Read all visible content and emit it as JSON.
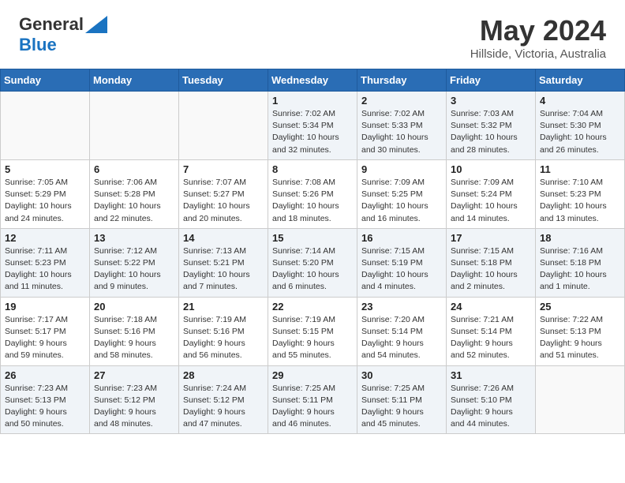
{
  "header": {
    "logo_general": "General",
    "logo_blue": "Blue",
    "month_year": "May 2024",
    "location": "Hillside, Victoria, Australia"
  },
  "days_of_week": [
    "Sunday",
    "Monday",
    "Tuesday",
    "Wednesday",
    "Thursday",
    "Friday",
    "Saturday"
  ],
  "weeks": [
    [
      {
        "num": "",
        "info": ""
      },
      {
        "num": "",
        "info": ""
      },
      {
        "num": "",
        "info": ""
      },
      {
        "num": "1",
        "info": "Sunrise: 7:02 AM\nSunset: 5:34 PM\nDaylight: 10 hours\nand 32 minutes."
      },
      {
        "num": "2",
        "info": "Sunrise: 7:02 AM\nSunset: 5:33 PM\nDaylight: 10 hours\nand 30 minutes."
      },
      {
        "num": "3",
        "info": "Sunrise: 7:03 AM\nSunset: 5:32 PM\nDaylight: 10 hours\nand 28 minutes."
      },
      {
        "num": "4",
        "info": "Sunrise: 7:04 AM\nSunset: 5:30 PM\nDaylight: 10 hours\nand 26 minutes."
      }
    ],
    [
      {
        "num": "5",
        "info": "Sunrise: 7:05 AM\nSunset: 5:29 PM\nDaylight: 10 hours\nand 24 minutes."
      },
      {
        "num": "6",
        "info": "Sunrise: 7:06 AM\nSunset: 5:28 PM\nDaylight: 10 hours\nand 22 minutes."
      },
      {
        "num": "7",
        "info": "Sunrise: 7:07 AM\nSunset: 5:27 PM\nDaylight: 10 hours\nand 20 minutes."
      },
      {
        "num": "8",
        "info": "Sunrise: 7:08 AM\nSunset: 5:26 PM\nDaylight: 10 hours\nand 18 minutes."
      },
      {
        "num": "9",
        "info": "Sunrise: 7:09 AM\nSunset: 5:25 PM\nDaylight: 10 hours\nand 16 minutes."
      },
      {
        "num": "10",
        "info": "Sunrise: 7:09 AM\nSunset: 5:24 PM\nDaylight: 10 hours\nand 14 minutes."
      },
      {
        "num": "11",
        "info": "Sunrise: 7:10 AM\nSunset: 5:23 PM\nDaylight: 10 hours\nand 13 minutes."
      }
    ],
    [
      {
        "num": "12",
        "info": "Sunrise: 7:11 AM\nSunset: 5:23 PM\nDaylight: 10 hours\nand 11 minutes."
      },
      {
        "num": "13",
        "info": "Sunrise: 7:12 AM\nSunset: 5:22 PM\nDaylight: 10 hours\nand 9 minutes."
      },
      {
        "num": "14",
        "info": "Sunrise: 7:13 AM\nSunset: 5:21 PM\nDaylight: 10 hours\nand 7 minutes."
      },
      {
        "num": "15",
        "info": "Sunrise: 7:14 AM\nSunset: 5:20 PM\nDaylight: 10 hours\nand 6 minutes."
      },
      {
        "num": "16",
        "info": "Sunrise: 7:15 AM\nSunset: 5:19 PM\nDaylight: 10 hours\nand 4 minutes."
      },
      {
        "num": "17",
        "info": "Sunrise: 7:15 AM\nSunset: 5:18 PM\nDaylight: 10 hours\nand 2 minutes."
      },
      {
        "num": "18",
        "info": "Sunrise: 7:16 AM\nSunset: 5:18 PM\nDaylight: 10 hours\nand 1 minute."
      }
    ],
    [
      {
        "num": "19",
        "info": "Sunrise: 7:17 AM\nSunset: 5:17 PM\nDaylight: 9 hours\nand 59 minutes."
      },
      {
        "num": "20",
        "info": "Sunrise: 7:18 AM\nSunset: 5:16 PM\nDaylight: 9 hours\nand 58 minutes."
      },
      {
        "num": "21",
        "info": "Sunrise: 7:19 AM\nSunset: 5:16 PM\nDaylight: 9 hours\nand 56 minutes."
      },
      {
        "num": "22",
        "info": "Sunrise: 7:19 AM\nSunset: 5:15 PM\nDaylight: 9 hours\nand 55 minutes."
      },
      {
        "num": "23",
        "info": "Sunrise: 7:20 AM\nSunset: 5:14 PM\nDaylight: 9 hours\nand 54 minutes."
      },
      {
        "num": "24",
        "info": "Sunrise: 7:21 AM\nSunset: 5:14 PM\nDaylight: 9 hours\nand 52 minutes."
      },
      {
        "num": "25",
        "info": "Sunrise: 7:22 AM\nSunset: 5:13 PM\nDaylight: 9 hours\nand 51 minutes."
      }
    ],
    [
      {
        "num": "26",
        "info": "Sunrise: 7:23 AM\nSunset: 5:13 PM\nDaylight: 9 hours\nand 50 minutes."
      },
      {
        "num": "27",
        "info": "Sunrise: 7:23 AM\nSunset: 5:12 PM\nDaylight: 9 hours\nand 48 minutes."
      },
      {
        "num": "28",
        "info": "Sunrise: 7:24 AM\nSunset: 5:12 PM\nDaylight: 9 hours\nand 47 minutes."
      },
      {
        "num": "29",
        "info": "Sunrise: 7:25 AM\nSunset: 5:11 PM\nDaylight: 9 hours\nand 46 minutes."
      },
      {
        "num": "30",
        "info": "Sunrise: 7:25 AM\nSunset: 5:11 PM\nDaylight: 9 hours\nand 45 minutes."
      },
      {
        "num": "31",
        "info": "Sunrise: 7:26 AM\nSunset: 5:10 PM\nDaylight: 9 hours\nand 44 minutes."
      },
      {
        "num": "",
        "info": ""
      }
    ]
  ]
}
